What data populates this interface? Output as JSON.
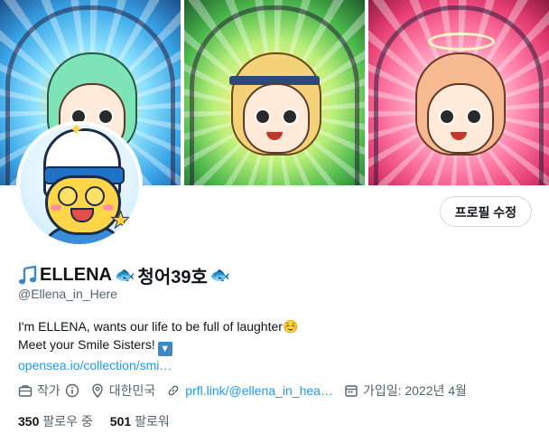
{
  "banner": {
    "panels": [
      "panel-green-hair",
      "panel-blonde-hair",
      "panel-pink-hair"
    ]
  },
  "profile": {
    "edit_button": "프로필 수정",
    "name_prefix_icon": "music-note-icon",
    "name_part1": "ELLENA",
    "name_part2": "청어39호",
    "fish_icon": "🐟",
    "handle": "@Ellena_in_Here"
  },
  "bio": {
    "line1": "I'm ELLENA, wants our life to be full of laughter",
    "line1_emoji": "☺️",
    "line2": "Meet your Smile Sisters!",
    "line2_emoji": "🔽",
    "link": "opensea.io/collection/smi…"
  },
  "meta": {
    "category": "작가",
    "location": "대한민국",
    "website": "prfl.link/@ellena_in_hea…",
    "joined": "가입일: 2022년 4월"
  },
  "follow": {
    "following_count": "350",
    "following_label": "팔로우 중",
    "followers_count": "501",
    "followers_label": "팔로워"
  },
  "colors": {
    "link": "#1d9bf0",
    "secondary_text": "#536471",
    "primary_text": "#0f1419"
  }
}
